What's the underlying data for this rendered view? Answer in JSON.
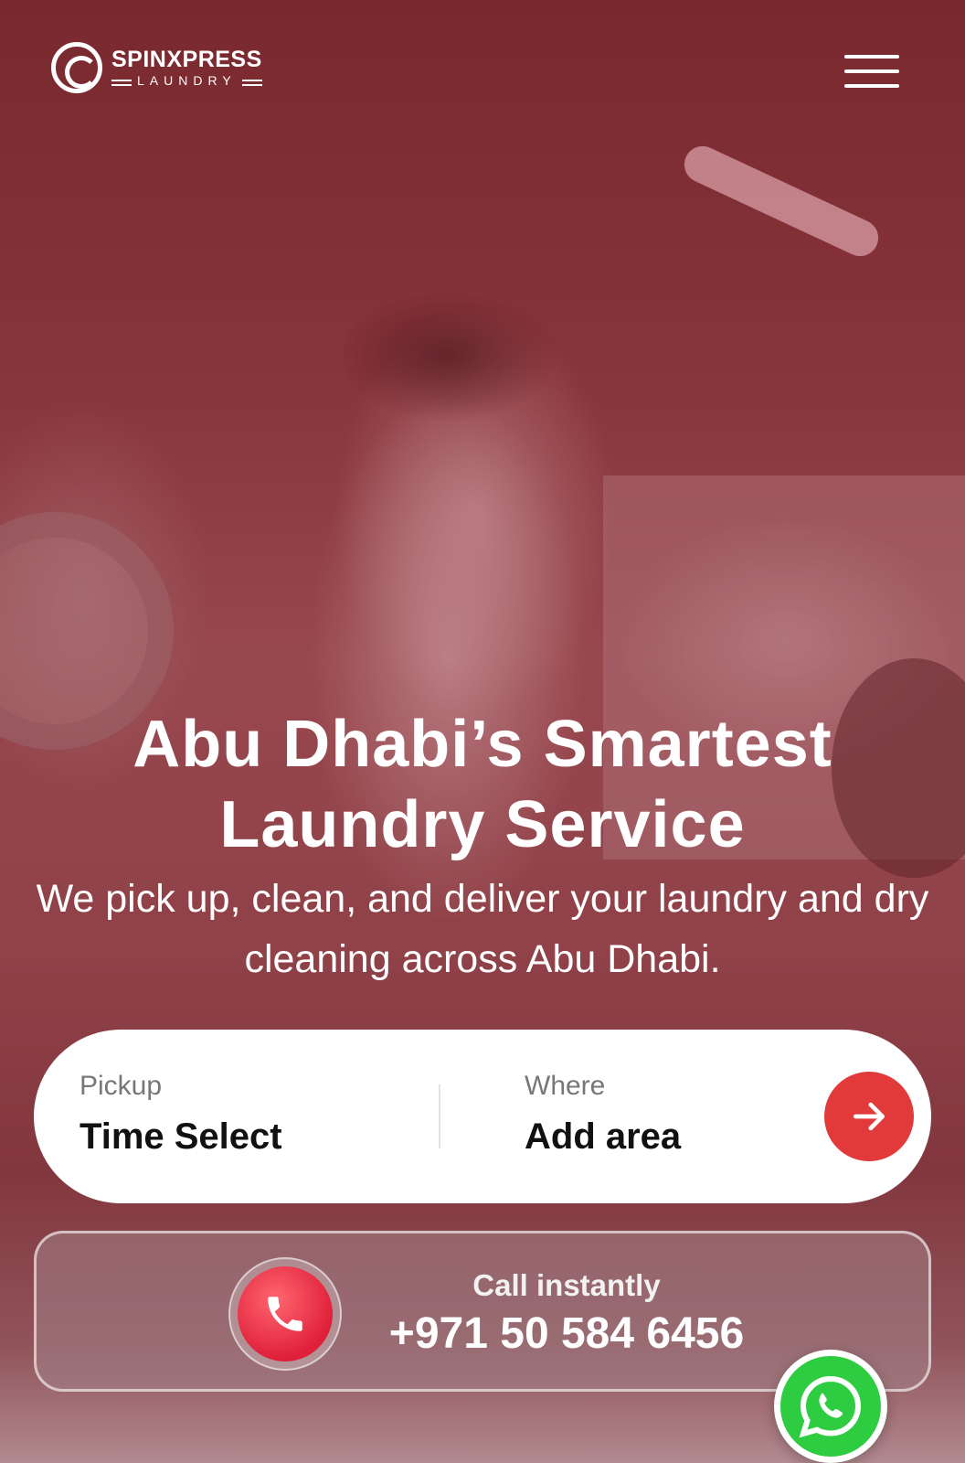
{
  "brand": {
    "name_top": "SPINXPRESS",
    "name_bottom": "LAUNDRY"
  },
  "header": {
    "menu_icon": "hamburger-menu-icon"
  },
  "hero": {
    "title_line1": "Abu Dhabi’s Smartest",
    "title_line2": "Laundry Service",
    "subtitle": "We pick up, clean, and deliver your laundry and dry cleaning across Abu Dhabi."
  },
  "booking": {
    "pickup_label": "Pickup",
    "pickup_value": "Time Select",
    "where_label": "Where",
    "where_value": "Add area",
    "submit_icon": "arrow-right-icon"
  },
  "call": {
    "label": "Call instantly",
    "number": "+971 50 584 6456",
    "icon": "phone-icon"
  },
  "whatsapp": {
    "icon": "whatsapp-icon"
  },
  "colors": {
    "accent": "#e23a3a",
    "overlay": "#7a2f33",
    "whatsapp": "#2ecc40"
  }
}
